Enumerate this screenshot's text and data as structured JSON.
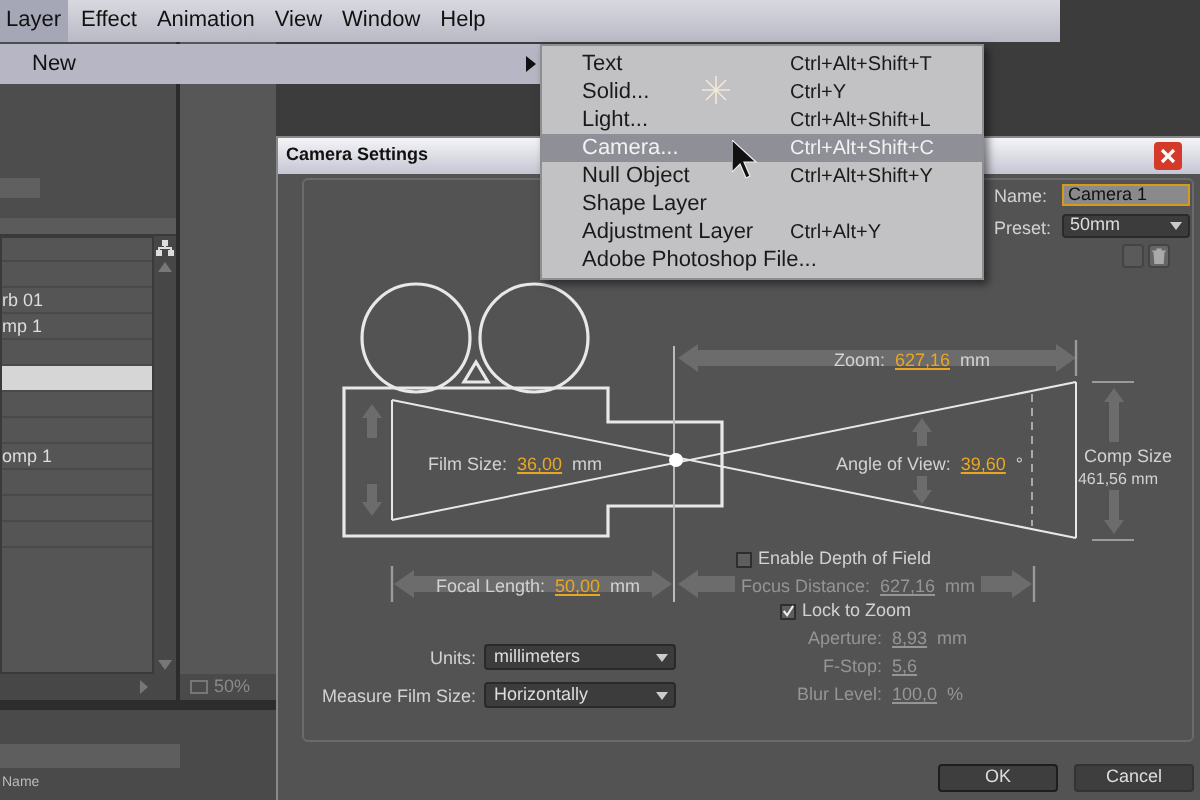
{
  "menu_bar": {
    "items": [
      {
        "label": "Layer",
        "selected": true
      },
      {
        "label": "Effect",
        "selected": false
      },
      {
        "label": "Animation",
        "selected": false
      },
      {
        "label": "View",
        "selected": false
      },
      {
        "label": "Window",
        "selected": false
      },
      {
        "label": "Help",
        "selected": false
      }
    ]
  },
  "layer_menu": {
    "items": [
      {
        "label": "New",
        "selected": true
      }
    ]
  },
  "new_submenu": {
    "items": [
      {
        "label": "Text",
        "shortcut": "Ctrl+Alt+Shift+T",
        "selected": false
      },
      {
        "label": "Solid...",
        "shortcut": "Ctrl+Y",
        "selected": false
      },
      {
        "label": "Light...",
        "shortcut": "Ctrl+Alt+Shift+L",
        "selected": false
      },
      {
        "label": "Camera...",
        "shortcut": "Ctrl+Alt+Shift+C",
        "selected": true
      },
      {
        "label": "Null Object",
        "shortcut": "Ctrl+Alt+Shift+Y",
        "selected": false
      },
      {
        "label": "Shape Layer",
        "selected": false
      },
      {
        "label": "Adjustment Layer",
        "shortcut": "Ctrl+Alt+Y",
        "selected": false
      },
      {
        "label": "Adobe Photoshop File...",
        "selected": false
      }
    ]
  },
  "project_panel": {
    "rows": [
      {
        "selected": false
      },
      {
        "name": "rb 01",
        "selected": false
      },
      {
        "name": "mp 1",
        "selected": false
      },
      {
        "selected": false
      },
      {
        "selected": true
      },
      {
        "selected": false
      },
      {
        "selected": false
      },
      {
        "name": "omp 1",
        "selected": false
      },
      {
        "selected": false
      },
      {
        "selected": false
      },
      {
        "selected": false
      }
    ]
  },
  "viewer": {
    "zoom": "50%"
  },
  "timeline": {
    "column": "Name"
  },
  "dialog": {
    "title": "Camera Settings",
    "name": {
      "label": "Name:",
      "value": "Camera 1"
    },
    "preset": {
      "label": "Preset:",
      "value": "50mm"
    },
    "zoom": {
      "label": "Zoom:",
      "value": "627,16",
      "unit": "mm"
    },
    "film_size": {
      "label": "Film Size:",
      "value": "36,00",
      "unit": "mm"
    },
    "angle_of_view": {
      "label": "Angle of View:",
      "value": "39,60",
      "unit": "°"
    },
    "comp_size": {
      "label": "Comp Size",
      "value": "461,56 mm"
    },
    "depth_of_field": {
      "label": "Enable Depth of Field",
      "checked": false
    },
    "focal_length": {
      "label": "Focal Length:",
      "value": "50,00",
      "unit": "mm"
    },
    "focus_distance": {
      "label": "Focus Distance:",
      "value": "627,16",
      "unit": "mm",
      "disabled": true
    },
    "lock_to_zoom": {
      "label": "Lock to Zoom",
      "checked": true
    },
    "dof_fields": [
      {
        "label": "Aperture:",
        "value": "8,93",
        "unit": "mm",
        "disabled": true
      },
      {
        "label": "F-Stop:",
        "value": "5,6",
        "disabled": true
      },
      {
        "label": "Blur Level:",
        "value": "100,0",
        "unit": "%",
        "disabled": true
      }
    ],
    "units": {
      "label": "Units:",
      "value": "millimeters"
    },
    "measure_film_size": {
      "label": "Measure Film Size:",
      "value": "Horizontally"
    },
    "buttons": [
      {
        "label": "OK"
      },
      {
        "label": "Cancel"
      }
    ]
  }
}
